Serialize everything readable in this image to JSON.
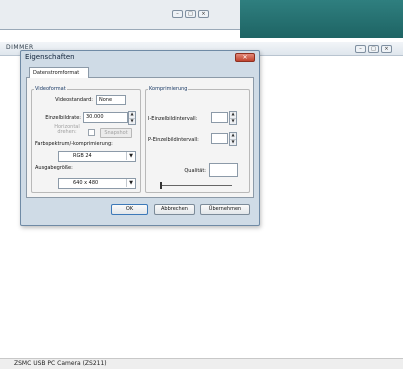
{
  "main_window": {
    "title": "DIMMER",
    "status_text": "ZSMC USB PC Camera (ZS211)"
  },
  "caption_icons": [
    "minimize-icon",
    "maximize-icon",
    "close-icon"
  ],
  "caption_glyphs": {
    "minimize": "–",
    "maximize": "□",
    "close": "×"
  },
  "dialog": {
    "title": "Eigenschaften",
    "close_glyph": "✕",
    "tab_label": "Datenstromformat",
    "videoformat": {
      "group_label": "Videoformat",
      "videostandard_label": "Videostandard:",
      "videostandard_value": "None",
      "einzelbildrate_label": "Einzelbildrate:",
      "einzelbildrate_value": "30.000",
      "horizontal_label": "Horizontal drehen:",
      "snapshot_label": "Snapshot",
      "farbspektrum_label": "Farbspektrum/-komprimierung:",
      "farbspektrum_value": "RGB 24",
      "ausgabegroesse_label": "Ausgabegröße:",
      "ausgabegroesse_value": "640 x 480"
    },
    "komprimierung": {
      "group_label": "Komprimierung",
      "i_intervall_label": "I-Einzelbildintervall:",
      "p_intervall_label": "P-Einzelbildintervall:",
      "qualitaet_label": "Qualität:"
    },
    "buttons": {
      "ok": "OK",
      "abbrechen": "Abbrechen",
      "uebernehmen": "Übernehmen"
    }
  },
  "spin_glyphs": {
    "up": "▲",
    "down": "▼"
  },
  "dropdown_glyph": "▼"
}
